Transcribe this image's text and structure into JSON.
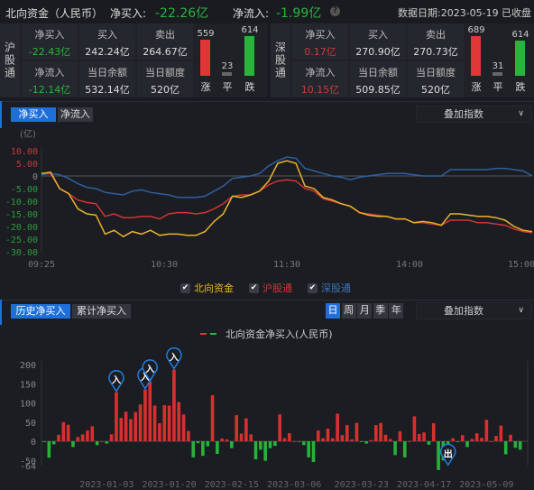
{
  "header": {
    "title": "北向资金（人民币）",
    "net_buy_label": "净买入:",
    "net_buy_value": "-22.26亿",
    "net_flow_label": "净流入:",
    "net_flow_value": "-1.99亿",
    "help_icon": "question-circle-icon",
    "date_label": "数据日期:2023-05-19",
    "status": "已收盘"
  },
  "panels": [
    {
      "name": "沪股通",
      "net_buy_label": "净买入",
      "net_buy": "-22.43亿",
      "buy_label": "买入",
      "buy": "242.24亿",
      "sell_label": "卖出",
      "sell": "264.67亿",
      "net_flow_label": "净流入",
      "net_flow": "-12.14亿",
      "balance_label": "当日余额",
      "balance": "532.14亿",
      "quota_label": "当日额度",
      "quota": "520亿",
      "up": "559",
      "flat": "23",
      "down": "614",
      "up_label": "涨",
      "flat_label": "平",
      "down_label": "跌",
      "sign": "neg"
    },
    {
      "name": "深股通",
      "net_buy_label": "净买入",
      "net_buy": "0.17亿",
      "buy_label": "买入",
      "buy": "270.90亿",
      "sell_label": "卖出",
      "sell": "270.73亿",
      "net_flow_label": "净流入",
      "net_flow": "10.15亿",
      "balance_label": "当日余额",
      "balance": "509.85亿",
      "quota_label": "当日额度",
      "quota": "520亿",
      "up": "689",
      "flat": "31",
      "down": "614",
      "up_label": "涨",
      "flat_label": "平",
      "down_label": "跌",
      "sign": "pos"
    }
  ],
  "intraday": {
    "tabs": [
      "净买入",
      "净流入"
    ],
    "active_tab": 0,
    "overlay_label": "叠加指数"
  },
  "history": {
    "tabs": [
      "历史净买入",
      "累计净买入"
    ],
    "active_tab": 0,
    "periods": [
      "日",
      "周",
      "月",
      "季",
      "年"
    ],
    "active_period": 0,
    "overlay_label": "叠加指数"
  },
  "colors": {
    "accent": "#1e6fd9",
    "up": "#e03636",
    "down": "#2bb43c",
    "north": "#e8b32e",
    "sh": "#d23434",
    "sz": "#2f5f9e"
  },
  "chart_data": [
    {
      "type": "line",
      "unit_label": "(亿)",
      "ylim": [
        -30,
        10
      ],
      "yticks": [
        "10.00",
        "5.00",
        "0",
        "-5.00",
        "-10.00",
        "-15.00",
        "-20.00",
        "-25.00",
        "-30.00"
      ],
      "ytick_values": [
        10,
        5,
        0,
        -5,
        -10,
        -15,
        -20,
        -25,
        -30
      ],
      "xtick_labels": [
        "09:25",
        "10:30",
        "11:30",
        "14:00",
        "15:00"
      ],
      "x": [
        "09:25",
        "09:34",
        "09:37",
        "09:40",
        "09:45",
        "09:50",
        "09:52",
        "09:55",
        "10:00",
        "10:05",
        "10:10",
        "10:15",
        "10:20",
        "10:25",
        "10:30",
        "10:35",
        "10:40",
        "10:45",
        "10:50",
        "10:55",
        "11:00",
        "11:05",
        "11:10",
        "11:15",
        "11:20",
        "11:25",
        "11:28",
        "11:30",
        "13:03",
        "13:07",
        "13:10",
        "13:15",
        "13:20",
        "13:25",
        "13:30",
        "13:35",
        "13:40",
        "13:45",
        "13:50",
        "13:55",
        "14:00",
        "14:05",
        "14:10",
        "14:15",
        "14:20",
        "14:25",
        "14:28",
        "14:30",
        "14:35",
        "14:40",
        "14:45",
        "14:50",
        "14:55",
        "14:58",
        "15:00"
      ],
      "series": [
        {
          "name": "北向资金",
          "color": "#e8b32e",
          "values": [
            1,
            1.5,
            -5,
            -7,
            -13,
            -15,
            -15.5,
            -23,
            -21.5,
            -24,
            -22,
            -23,
            -21.5,
            -23.5,
            -23,
            -23,
            -23.5,
            -23.5,
            -22,
            -18,
            -15,
            -8,
            -8.5,
            -7.5,
            -6,
            -2,
            5,
            6,
            5,
            -4,
            -5,
            -8.5,
            -9.5,
            -11,
            -12,
            -14.5,
            -15.5,
            -16,
            -16,
            -17,
            -17,
            -18.5,
            -18,
            -18.5,
            -19.5,
            -15,
            -15,
            -15.5,
            -16,
            -16,
            -16.5,
            -17.5,
            -20,
            -21.5,
            -22
          ]
        },
        {
          "name": "沪股通",
          "color": "#d23434",
          "values": [
            1,
            1,
            -5,
            -7,
            -9.5,
            -10.5,
            -11,
            -16,
            -15,
            -16.5,
            -16.5,
            -16,
            -16,
            -17,
            -15,
            -14.5,
            -14.5,
            -15,
            -14.5,
            -13,
            -11,
            -8,
            -7.5,
            -7.5,
            -6,
            -3.5,
            -2,
            -1.5,
            -2,
            -5,
            -6,
            -9,
            -10,
            -11,
            -12,
            -14.5,
            -15,
            -15.5,
            -16,
            -17,
            -17,
            -18.5,
            -18.5,
            -19,
            -19.5,
            -17.5,
            -17.5,
            -17.5,
            -18.5,
            -18.5,
            -19,
            -19.5,
            -21,
            -22,
            -22.5
          ]
        },
        {
          "name": "深股通",
          "color": "#2f5f9e",
          "values": [
            0.5,
            1,
            0.5,
            -1,
            -3,
            -4.5,
            -5,
            -6.5,
            -7,
            -7.5,
            -6,
            -5.5,
            -6.5,
            -7,
            -7.5,
            -8.5,
            -8.5,
            -8.5,
            -8,
            -6,
            -4,
            -1,
            -0.5,
            0,
            1,
            4,
            6,
            7.5,
            7,
            3,
            2,
            1,
            0,
            -0.5,
            -1.5,
            -0.5,
            0,
            0.5,
            1,
            1,
            1,
            0.5,
            0,
            0,
            0,
            2.5,
            2.5,
            2.5,
            2.5,
            2.5,
            3,
            3,
            2.5,
            2,
            0
          ]
        }
      ]
    },
    {
      "type": "bar",
      "legend": "北向资金净买入(人民币)",
      "ylim": [
        -64,
        200
      ],
      "yticks": [
        "200",
        "150",
        "100",
        "50",
        "0",
        "-50",
        "-64"
      ],
      "ytick_values": [
        200,
        150,
        100,
        50,
        0,
        -50,
        -64
      ],
      "xtick_labels": [
        "2023-01-03",
        "2023-01-20",
        "2023-02-15",
        "2023-03-06",
        "2023-03-23",
        "2023-04-17",
        "2023-05-09"
      ],
      "xtick_bar_index": [
        13,
        26,
        39,
        52,
        66,
        79,
        92
      ],
      "values": [
        -2,
        -43,
        -8,
        17,
        50,
        43,
        -15,
        11,
        18,
        28,
        39,
        -10,
        0,
        -6,
        18,
        128,
        61,
        77,
        58,
        76,
        96,
        135,
        156,
        93,
        47,
        94,
        93,
        187,
        102,
        70,
        27,
        -42,
        -5,
        -38,
        -13,
        120,
        -33,
        7,
        5,
        -18,
        68,
        20,
        60,
        18,
        -47,
        -22,
        -51,
        -18,
        -12,
        70,
        8,
        21,
        0,
        -1,
        -10,
        -42,
        -54,
        28,
        8,
        33,
        8,
        72,
        16,
        42,
        5,
        48,
        -2,
        -6,
        3,
        42,
        48,
        17,
        6,
        -36,
        26,
        -42,
        0,
        65,
        19,
        23,
        -9,
        47,
        -75,
        -50,
        -50,
        8,
        -2,
        16,
        -15,
        6,
        21,
        9,
        56,
        0,
        14,
        41,
        -34,
        17,
        -17,
        -22
      ],
      "markers": [
        {
          "bar_index": 15,
          "label": "入"
        },
        {
          "bar_index": 21,
          "label": "入"
        },
        {
          "bar_index": 22,
          "label": "入"
        },
        {
          "bar_index": 27,
          "label": "入"
        },
        {
          "bar_index": 84,
          "label": "出"
        }
      ]
    }
  ]
}
